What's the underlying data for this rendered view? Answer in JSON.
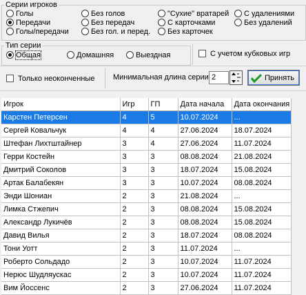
{
  "series_group": {
    "title": "Серии игроков",
    "options": [
      {
        "label": "Голы",
        "selected": false
      },
      {
        "label": "Передачи",
        "selected": true
      },
      {
        "label": "Голы/передачи",
        "selected": false
      },
      {
        "label": "Без голов",
        "selected": false
      },
      {
        "label": "Без передач",
        "selected": false
      },
      {
        "label": "Без гол. и перед.",
        "selected": false
      },
      {
        "label": "\"Сухие\" вратарей",
        "selected": false
      },
      {
        "label": "С карточками",
        "selected": false
      },
      {
        "label": "Без карточек",
        "selected": false
      },
      {
        "label": "С удалениями",
        "selected": false
      },
      {
        "label": "Без удалений",
        "selected": false
      }
    ]
  },
  "type_group": {
    "title": "Тип серии",
    "options": [
      {
        "label": "Общая",
        "selected": true
      },
      {
        "label": "Домашняя",
        "selected": false
      },
      {
        "label": "Выездная",
        "selected": false
      }
    ]
  },
  "cup_games": {
    "label": "С учетом кубковых игр",
    "checked": false
  },
  "unfinished_only": {
    "label": "Только неоконченные",
    "checked": false
  },
  "min_length": {
    "label": "Минимальная длина серии",
    "value": "2"
  },
  "apply_button": {
    "label": "Принять"
  },
  "table": {
    "columns": [
      "Игрок",
      "Игр",
      "ГП",
      "Дата начала",
      "Дата окончания"
    ],
    "selected_row": 0,
    "rows": [
      [
        "Карстен Петерсен",
        "4",
        "5",
        "10.07.2024",
        "..."
      ],
      [
        "Сергей Ковальчук",
        "4",
        "4",
        "27.06.2024",
        "18.07.2024"
      ],
      [
        "Штефан Лихтштайнер",
        "3",
        "4",
        "27.06.2024",
        "11.07.2024"
      ],
      [
        "Герри Костейн",
        "3",
        "3",
        "08.08.2024",
        "21.08.2024"
      ],
      [
        "Дмитрий Соколов",
        "3",
        "3",
        "18.07.2024",
        "15.08.2024"
      ],
      [
        "Артак Балабекян",
        "3",
        "3",
        "10.07.2024",
        "08.08.2024"
      ],
      [
        "Энди Шониан",
        "2",
        "3",
        "21.08.2024",
        "..."
      ],
      [
        "Лимка Стжепич",
        "2",
        "3",
        "08.08.2024",
        "15.08.2024"
      ],
      [
        "Александр Лукичёв",
        "2",
        "3",
        "08.08.2024",
        "15.08.2024"
      ],
      [
        "Давид Вилья",
        "2",
        "3",
        "18.07.2024",
        "08.08.2024"
      ],
      [
        "Тони Уотт",
        "2",
        "3",
        "11.07.2024",
        "..."
      ],
      [
        "Роберто Сольдадо",
        "2",
        "3",
        "10.07.2024",
        "11.07.2024"
      ],
      [
        "Нерюс Шудляускас",
        "2",
        "3",
        "10.07.2024",
        "11.07.2024"
      ],
      [
        "Вим Йоссенс",
        "2",
        "3",
        "27.06.2024",
        "11.07.2024"
      ]
    ]
  },
  "colors": {
    "selection": "#1a7be6",
    "apply_check": "#1a9a2a"
  }
}
